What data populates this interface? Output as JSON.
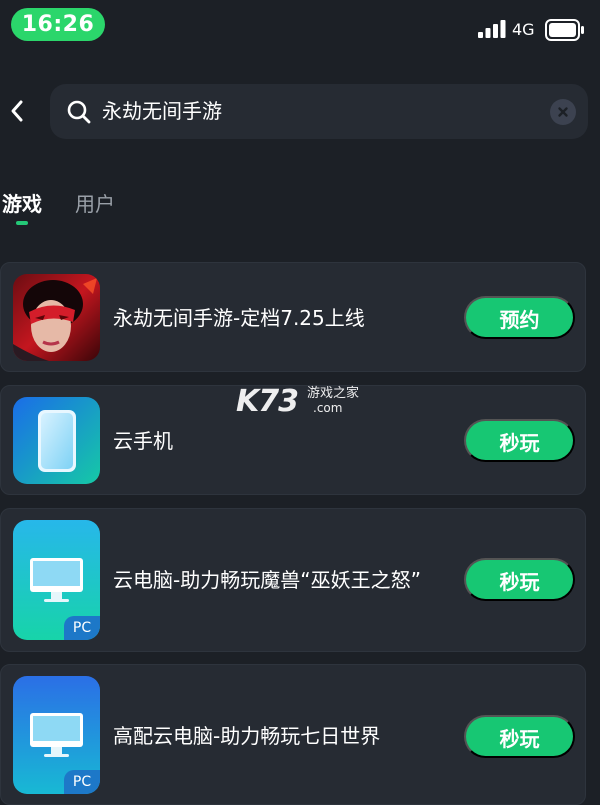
{
  "status_bar": {
    "time": "16:26",
    "network": "4G"
  },
  "search": {
    "query": "永劫无间手游"
  },
  "tabs": [
    {
      "label": "游戏",
      "active": true
    },
    {
      "label": "用户",
      "active": false
    }
  ],
  "results": [
    {
      "title": "永劫无间手游-定档7.25上线",
      "action": "预约",
      "icon": "naraka-game-icon"
    },
    {
      "title": "云手机",
      "action": "秒玩",
      "icon": "cloud-phone-icon"
    },
    {
      "title": "云电脑-助力畅玩魔兽“巫妖王之怒”",
      "action": "秒玩",
      "icon": "cloud-pc-icon",
      "badge": "PC"
    },
    {
      "title": "高配云电脑-助力畅玩七日世界",
      "action": "秒玩",
      "icon": "cloud-pc-icon",
      "badge": "PC"
    }
  ],
  "watermark": {
    "brand": "K73",
    "cn": "游戏之家",
    "domain": ".com"
  },
  "colors": {
    "background": "#1c2026",
    "card": "#262b33",
    "accent_green": "#17c773",
    "time_pill": "#2bd66b",
    "pc_badge": "#1d78c8"
  }
}
